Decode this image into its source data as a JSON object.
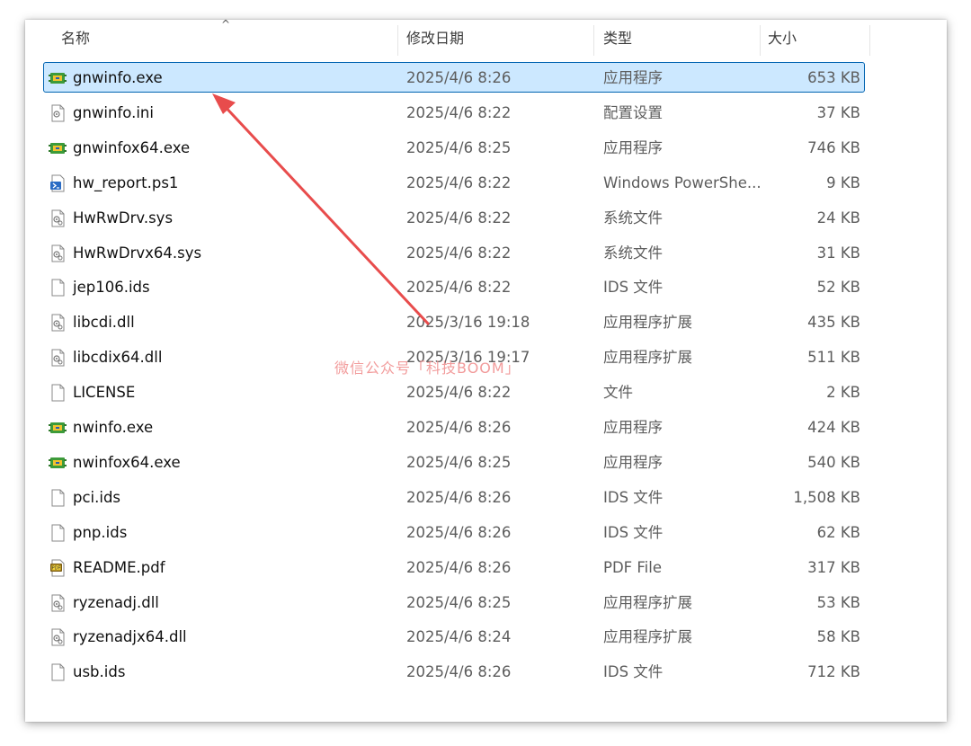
{
  "header": {
    "name": "名称",
    "date": "修改日期",
    "type": "类型",
    "size": "大小"
  },
  "files": [
    {
      "name": "gnwinfo.exe",
      "date": "2025/4/6 8:26",
      "type": "应用程序",
      "size": "653 KB",
      "icon": "exe-icon",
      "selected": true
    },
    {
      "name": "gnwinfo.ini",
      "date": "2025/4/6 8:22",
      "type": "配置设置",
      "size": "37 KB",
      "icon": "ini-icon"
    },
    {
      "name": "gnwinfox64.exe",
      "date": "2025/4/6 8:25",
      "type": "应用程序",
      "size": "746 KB",
      "icon": "exe-icon"
    },
    {
      "name": "hw_report.ps1",
      "date": "2025/4/6 8:22",
      "type": "Windows PowerShe...",
      "size": "9 KB",
      "icon": "ps1-icon"
    },
    {
      "name": "HwRwDrv.sys",
      "date": "2025/4/6 8:22",
      "type": "系统文件",
      "size": "24 KB",
      "icon": "sys-icon"
    },
    {
      "name": "HwRwDrvx64.sys",
      "date": "2025/4/6 8:22",
      "type": "系统文件",
      "size": "31 KB",
      "icon": "sys-icon"
    },
    {
      "name": "jep106.ids",
      "date": "2025/4/6 8:22",
      "type": "IDS 文件",
      "size": "52 KB",
      "icon": "blank-file-icon"
    },
    {
      "name": "libcdi.dll",
      "date": "2025/3/16 19:18",
      "type": "应用程序扩展",
      "size": "435 KB",
      "icon": "dll-icon"
    },
    {
      "name": "libcdix64.dll",
      "date": "2025/3/16 19:17",
      "type": "应用程序扩展",
      "size": "511 KB",
      "icon": "dll-icon"
    },
    {
      "name": "LICENSE",
      "date": "2025/4/6 8:22",
      "type": "文件",
      "size": "2 KB",
      "icon": "blank-file-icon"
    },
    {
      "name": "nwinfo.exe",
      "date": "2025/4/6 8:26",
      "type": "应用程序",
      "size": "424 KB",
      "icon": "exe-icon"
    },
    {
      "name": "nwinfox64.exe",
      "date": "2025/4/6 8:25",
      "type": "应用程序",
      "size": "540 KB",
      "icon": "exe-icon"
    },
    {
      "name": "pci.ids",
      "date": "2025/4/6 8:26",
      "type": "IDS 文件",
      "size": "1,508 KB",
      "icon": "blank-file-icon"
    },
    {
      "name": "pnp.ids",
      "date": "2025/4/6 8:26",
      "type": "IDS 文件",
      "size": "62 KB",
      "icon": "blank-file-icon"
    },
    {
      "name": "README.pdf",
      "date": "2025/4/6 8:26",
      "type": "PDF File",
      "size": "317 KB",
      "icon": "pdf-icon"
    },
    {
      "name": "ryzenadj.dll",
      "date": "2025/4/6 8:25",
      "type": "应用程序扩展",
      "size": "53 KB",
      "icon": "dll-icon"
    },
    {
      "name": "ryzenadjx64.dll",
      "date": "2025/4/6 8:24",
      "type": "应用程序扩展",
      "size": "58 KB",
      "icon": "dll-icon"
    },
    {
      "name": "usb.ids",
      "date": "2025/4/6 8:26",
      "type": "IDS 文件",
      "size": "712 KB",
      "icon": "blank-file-icon"
    }
  ],
  "watermark": "微信公众号「科技BOOM」",
  "colors": {
    "selection_bg": "#cce8ff",
    "selection_border": "#0063b1",
    "arrow": "#e84c4c",
    "watermark": "#f08b8b"
  }
}
